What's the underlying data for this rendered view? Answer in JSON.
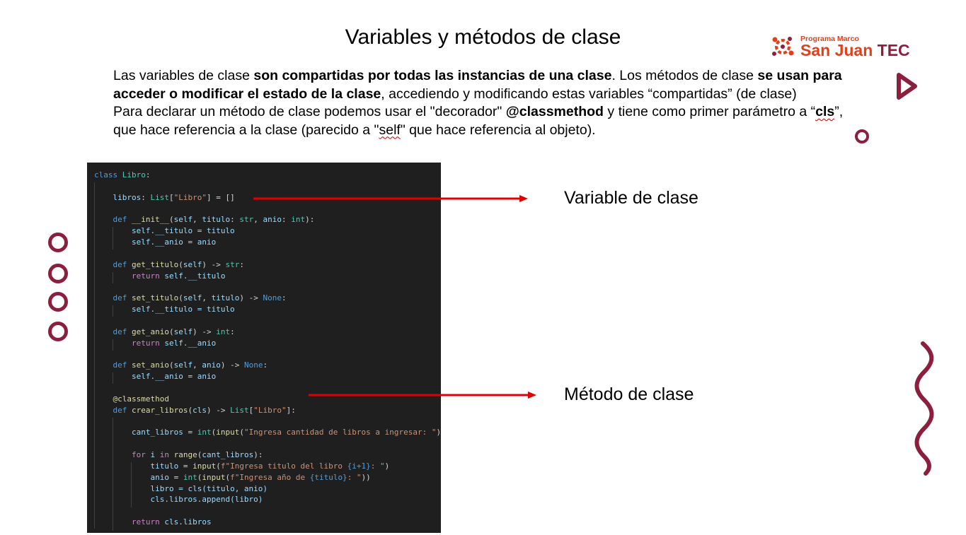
{
  "slide": {
    "title": "Variables y métodos de clase",
    "intro": {
      "p1_a": "Las variables de clase ",
      "p1_b": "son compartidas por todas las instancias de una clase",
      "p1_c": ". Los métodos de clase ",
      "p1_d": "se usan para acceder o modificar el estado de la clase",
      "p1_e": ", accediendo y modificando estas variables “compartidas” (de clase)",
      "p2_a": "Para declarar un método de clase podemos usar el \"decorador\" ",
      "p2_b": "@classmethod",
      "p2_c": " y tiene como primer parámetro a “",
      "p2_d": "cls",
      "p2_e": "”, que hace referencia a la clase (parecido a \"",
      "p2_f": "self",
      "p2_g": "\" que hace referencia al objeto)."
    },
    "logo": {
      "small": "Programa Marco",
      "big_a": "San Juan",
      "big_b": "TEC"
    },
    "labels": {
      "class_variable": "Variable de clase",
      "class_method": "Método de clase"
    },
    "colors": {
      "accent": "#8b1f3d",
      "arrow": "#e00000",
      "logo_orange": "#e2401c",
      "code_bg": "#1f1f1f"
    }
  },
  "code": {
    "l1_kw": "class",
    "l1_name": "Libro",
    "l1_end": ":",
    "l3_var": "libros",
    "l3_colon": ": ",
    "l3_type": "List",
    "l3_str": "\"Libro\"",
    "l3_rest": " = []",
    "l5_kw": "def",
    "l5_fn": "__init__",
    "l5_self": "self",
    "l5_p1": "titulo",
    "l5_t1": "str",
    "l5_p2": "anio",
    "l5_t2": "int",
    "l6": "self.__titulo = titulo",
    "l7": "self.__anio = anio",
    "l9_kw": "def",
    "l9_fn": "get_titulo",
    "l9_self": "self",
    "l9_ret": "str",
    "l10_kw": "return",
    "l10_rest": "self.__titulo",
    "l12_kw": "def",
    "l12_fn": "set_titulo",
    "l12_self": "self",
    "l12_p": "titulo",
    "l12_ret": "None",
    "l13": "self.__titulo = titulo",
    "l15_kw": "def",
    "l15_fn": "get_anio",
    "l15_self": "self",
    "l15_ret": "int",
    "l16_kw": "return",
    "l16_rest": "self.__anio",
    "l18_kw": "def",
    "l18_fn": "set_anio",
    "l18_self": "self",
    "l18_p": "anio",
    "l18_ret": "None",
    "l19": "self.__anio = anio",
    "l21_dec": "@classmethod",
    "l22_kw": "def",
    "l22_fn": "crear_libros",
    "l22_cls": "cls",
    "l22_type": "List",
    "l22_str": "\"Libro\"",
    "l24_var": "cant_libros",
    "l24_int": "int",
    "l24_input": "input",
    "l24_str": "\"Ingresa cantidad de libros a ingresar: \"",
    "l26_for": "for",
    "l26_i": "i",
    "l26_in": "in",
    "l26_range": "range",
    "l26_arg": "cant_libros",
    "l27_var": "titulo",
    "l27_input": "input",
    "l27_s1": "f\"Ingresa titulo del libro ",
    "l27_expr": "{i+1}",
    "l27_s2": ": \"",
    "l28_var": "anio",
    "l28_int": "int",
    "l28_input": "input",
    "l28_s1": "f\"Ingresa año de ",
    "l28_expr": "{titulo}",
    "l28_s2": ": \"",
    "l29": "libro = cls(titulo, anio)",
    "l30": "cls.libros.append(libro)",
    "l32_kw": "return",
    "l32_rest": "cls.libros"
  }
}
